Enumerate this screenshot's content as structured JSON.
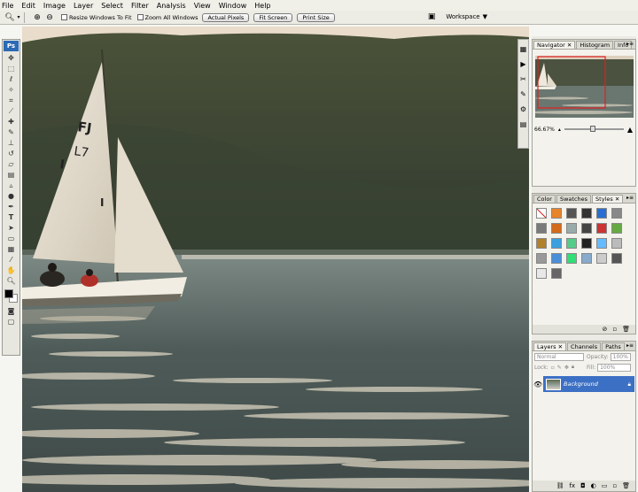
{
  "menu": [
    "File",
    "Edit",
    "Image",
    "Layer",
    "Select",
    "Filter",
    "Analysis",
    "View",
    "Window",
    "Help"
  ],
  "options": {
    "resize_label": "Resize Windows To Fit",
    "zoom_all_label": "Zoom All Windows",
    "actual_pixels": "Actual Pixels",
    "fit_screen": "Fit Screen",
    "print_size": "Print Size",
    "workspace": "Workspace"
  },
  "toolbox": {
    "logo": "Ps"
  },
  "navigator": {
    "tabs": [
      "Navigator",
      "Histogram",
      "Info"
    ],
    "zoom": "66.67%"
  },
  "styles_panel": {
    "tabs": [
      "Color",
      "Swatches",
      "Styles"
    ],
    "swatch_colors": [
      "#ffffff",
      "#e8842a",
      "#555555",
      "#333333",
      "#2a6fd0",
      "#888888",
      "#7a7a7a",
      "#d36a1c",
      "#9aa",
      "#444",
      "#c33",
      "#6a4",
      "#b0802a",
      "#3aa0e0",
      "#5c8",
      "#222",
      "#6bf",
      "#bbb",
      "#999",
      "#4a8fd8",
      "#3d7",
      "#8ac",
      "#ccc",
      "#555",
      "#e8e8e8",
      "#666"
    ]
  },
  "layers": {
    "tabs": [
      "Layers",
      "Channels",
      "Paths"
    ],
    "blend": "Normal",
    "opacity_label": "Opacity:",
    "opacity": "100%",
    "lock_label": "Lock:",
    "fill_label": "Fill:",
    "fill": "100%",
    "layer_name": "Background"
  },
  "sail_text": {
    "a": "FJ",
    "b": "L7",
    "c": "I",
    "d": "I"
  }
}
